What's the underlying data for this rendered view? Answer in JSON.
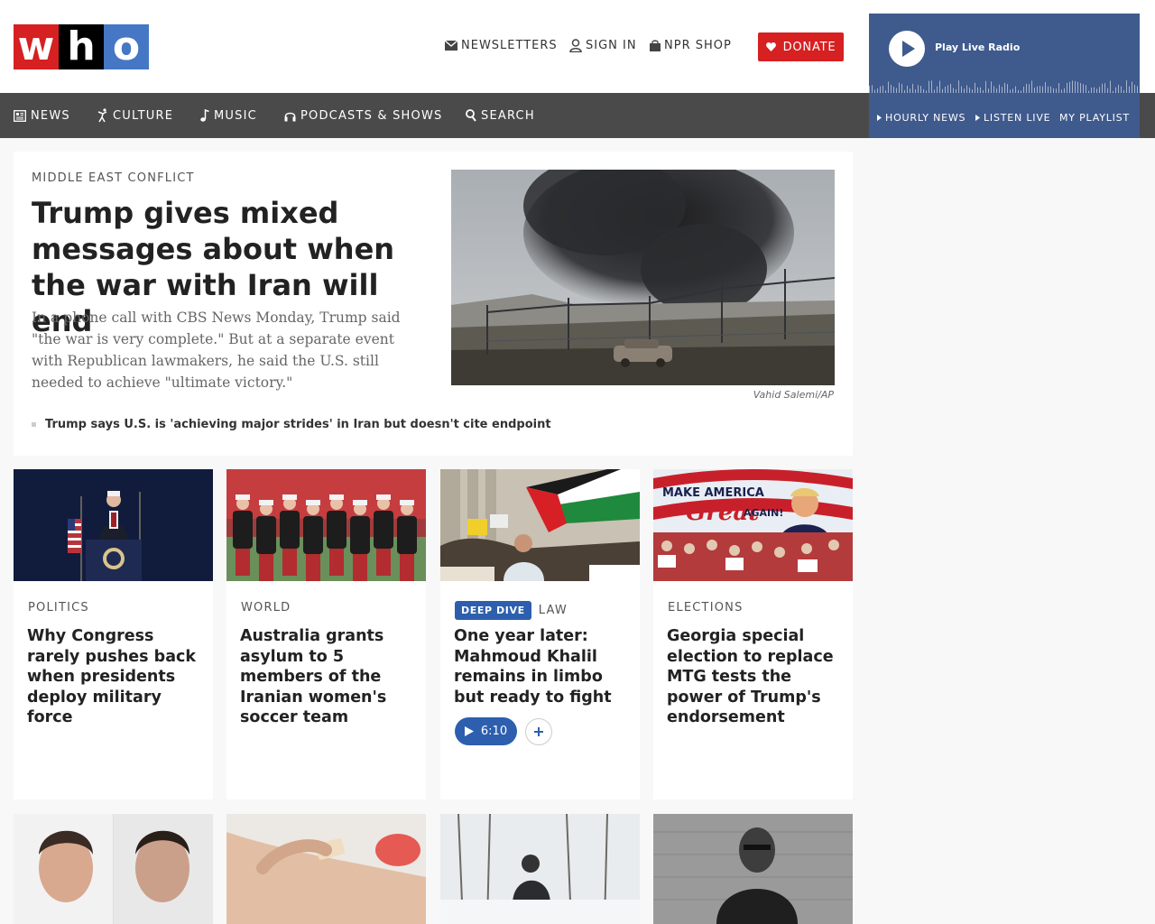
{
  "header": {
    "logo": {
      "letters": [
        "w",
        "h",
        "o"
      ],
      "colors": [
        "#d62021",
        "#000000",
        "#4577c4"
      ]
    },
    "utility": {
      "newsletters": "NEWSLETTERS",
      "signin": "SIGN IN",
      "shop": "NPR SHOP"
    },
    "donate": "DONATE"
  },
  "nav": {
    "items": [
      {
        "label": "NEWS",
        "icon": "newspaper-icon"
      },
      {
        "label": "CULTURE",
        "icon": "dancer-icon"
      },
      {
        "label": "MUSIC",
        "icon": "music-note-icon"
      },
      {
        "label": "PODCASTS & SHOWS",
        "icon": "headphones-icon"
      },
      {
        "label": "SEARCH",
        "icon": "search-icon"
      }
    ]
  },
  "player": {
    "play_label": "Play Live Radio",
    "links": [
      "HOURLY NEWS",
      "LISTEN LIVE",
      "MY PLAYLIST"
    ]
  },
  "hero": {
    "kicker": "MIDDLE EAST CONFLICT",
    "title": "Trump gives mixed messages about when the war with Iran will end",
    "teaser": "In a phone call with CBS News Monday, Trump said \"the war is very complete.\" But at a separate event with Republican lawmakers, he said the U.S. still needed to achieve \"ultimate victory.\"",
    "credit": "Vahid Salemi/AP",
    "related": "Trump says U.S. is 'achieving major strides' in Iran but doesn't cite endpoint"
  },
  "cards": [
    {
      "kicker": "POLITICS",
      "title": "Why Congress rarely pushes back when presidents deploy military force"
    },
    {
      "kicker": "WORLD",
      "title": "Australia grants asylum to 5 members of the Iranian women's soccer team"
    },
    {
      "badge": "DEEP DIVE",
      "kicker": "LAW",
      "title": "One year later: Mahmoud Khalil remains in limbo but ready to fight",
      "audio": "6:10"
    },
    {
      "kicker": "ELECTIONS",
      "title": "Georgia special election to replace MTG tests the power of Trump's endorsement",
      "image_text": [
        "MAKE AMERICA",
        "Great",
        "AGAIN!"
      ]
    }
  ],
  "colors": {
    "accent": "#d62021",
    "nav_bg": "#4a4a4a",
    "player_bg": "#3f5a8d",
    "badge": "#2d5fae"
  }
}
